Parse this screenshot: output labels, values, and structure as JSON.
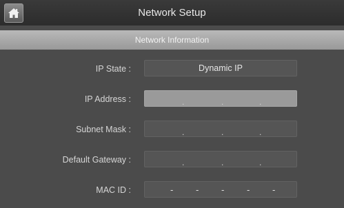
{
  "header": {
    "title": "Network Setup",
    "home_icon": "home-icon"
  },
  "section": {
    "title": "Network Information"
  },
  "fields": {
    "ip_state": {
      "label": "IP State :",
      "value": "Dynamic IP"
    },
    "ip_address": {
      "label": "IP Address :",
      "separators": [
        ".",
        ".",
        "."
      ]
    },
    "subnet_mask": {
      "label": "Subnet Mask :",
      "separators": [
        ".",
        ".",
        "."
      ]
    },
    "default_gateway": {
      "label": "Default Gateway :",
      "separators": [
        ".",
        ".",
        "."
      ]
    },
    "mac_id": {
      "label": "MAC ID :",
      "separators": [
        "-",
        "-",
        "-",
        "-",
        "-"
      ]
    }
  }
}
